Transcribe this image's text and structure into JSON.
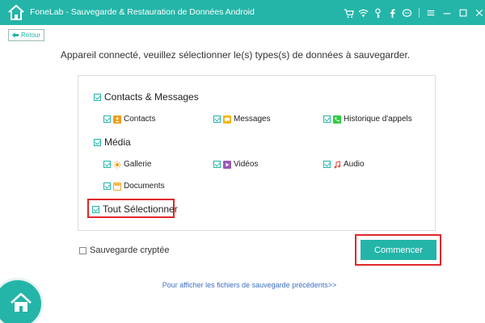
{
  "window": {
    "title": "FoneLab - Sauvegarde & Restauration de Données Android",
    "toolbar_icons": [
      "cart-icon",
      "wifi-icon",
      "key-icon",
      "facebook-icon",
      "chat-icon",
      "menu-icon"
    ],
    "window_controls": [
      "minimize-icon",
      "maximize-icon",
      "close-icon"
    ]
  },
  "back_label": "Retour",
  "instruction": "Appareil connecté, veuillez sélectionner le(s) types(s) de données à sauvegarder.",
  "groups": {
    "contacts_messages": {
      "label": "Contacts & Messages",
      "checked": true,
      "items": [
        {
          "label": "Contacts",
          "icon": "contacts-icon",
          "color": "#f39c12",
          "checked": true
        },
        {
          "label": "Messages",
          "icon": "messages-icon",
          "color": "#f5b400",
          "checked": true
        },
        {
          "label": "Historique d'appels",
          "icon": "phone-icon",
          "color": "#2ecc40",
          "checked": true
        }
      ]
    },
    "media": {
      "label": "Média",
      "checked": true,
      "items": [
        {
          "label": "Gallerie",
          "icon": "gallery-icon",
          "color": "#f39c12",
          "checked": true
        },
        {
          "label": "Vidéos",
          "icon": "video-icon",
          "color": "#9b59b6",
          "checked": true
        },
        {
          "label": "Audio",
          "icon": "audio-icon",
          "color": "#e74c3c",
          "checked": true
        },
        {
          "label": "Documents",
          "icon": "documents-icon",
          "color": "#f5a623",
          "checked": true
        }
      ]
    }
  },
  "select_all": {
    "label": "Tout Sélectionner",
    "checked": true
  },
  "encrypt": {
    "label": "Sauvegarde cryptée",
    "checked": false
  },
  "start_label": "Commencer",
  "view_backups_link": "Pour afficher les fichiers de sauvegarde précédents>>",
  "colors": {
    "accent": "#24b5a8",
    "highlight": "#e0272b",
    "link": "#3c6fc1"
  }
}
